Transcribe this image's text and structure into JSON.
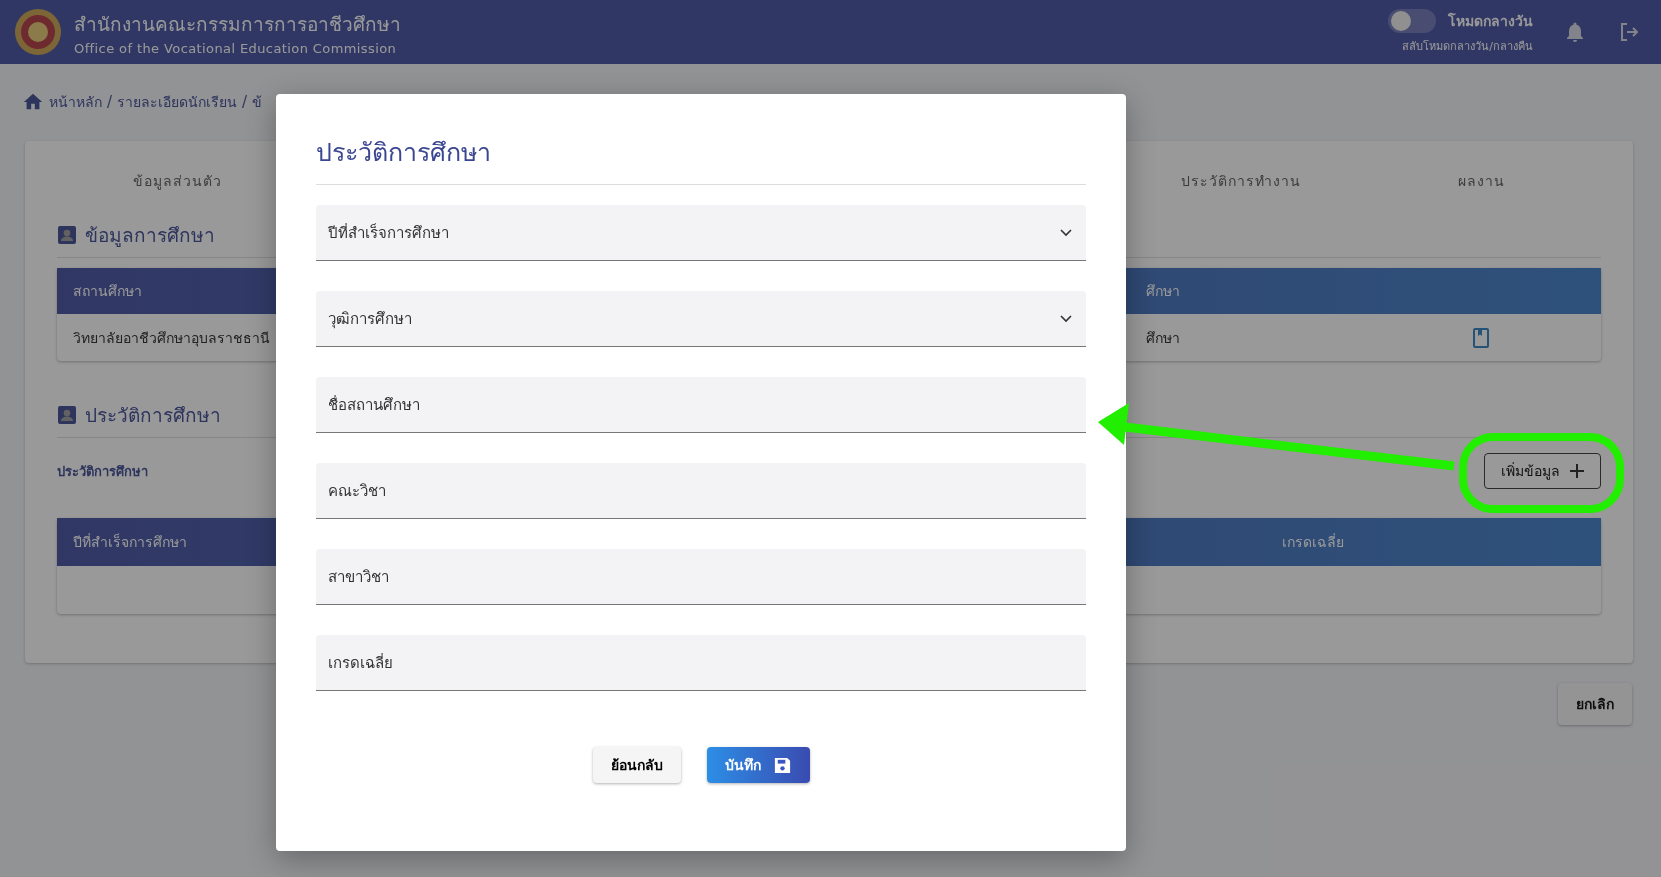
{
  "header": {
    "title": "สำนักงานคณะกรรมการการอาชีวศึกษา",
    "subtitle": "Office of the Vocational Education Commission",
    "mode_toggle": {
      "label": "โหมดกลางวัน",
      "caption": "สลับโหมดกลางวัน/กลางคืน",
      "on": false
    }
  },
  "breadcrumb": [
    {
      "kind": "link",
      "text": "หน้าหลัก"
    },
    {
      "kind": "separator",
      "text": "/"
    },
    {
      "kind": "link",
      "text": "รายละเอียดนักเรียน"
    },
    {
      "kind": "separator",
      "text": "/"
    },
    {
      "kind": "link",
      "text": "ข้"
    }
  ],
  "tabs": [
    {
      "label": "ข้อมูลส่วนตัว",
      "selected": false
    },
    {
      "label": "ประวัติการทำงาน",
      "selected": false
    },
    {
      "label": "ผลงาน",
      "selected": false
    }
  ],
  "education_section": {
    "heading": "ข้อมูลการศึกษา",
    "columns": [
      "สถานศึกษา",
      "ศึกษา"
    ],
    "rows": [
      [
        "วิทยาลัยอาชีวศึกษาอุบลราชธานี",
        "ศึกษา"
      ]
    ]
  },
  "history_section": {
    "heading": "ประวัติการศึกษา",
    "subheading": "ประวัติการศึกษา",
    "add_button": "เพิ่มข้อมูล",
    "columns": [
      "ปีที่สำเร็จการศึกษา",
      "เกรดเฉลี่ย"
    ]
  },
  "cancel_button": "ยกเลิก",
  "modal": {
    "title": "ประวัติการศึกษา",
    "fields": [
      {
        "kind": "select",
        "placeholder": "ปีที่สำเร็จการศึกษา"
      },
      {
        "kind": "select",
        "placeholder": "วุฒิการศึกษา"
      },
      {
        "kind": "text",
        "placeholder": "ชื่อสถานศึกษา"
      },
      {
        "kind": "text",
        "placeholder": "คณะวิชา"
      },
      {
        "kind": "text",
        "placeholder": "สาขาวิชา"
      },
      {
        "kind": "text",
        "placeholder": "เกรดเฉลี่ย"
      }
    ],
    "back_button": "ย้อนกลับ",
    "save_button": "บันทึก"
  }
}
